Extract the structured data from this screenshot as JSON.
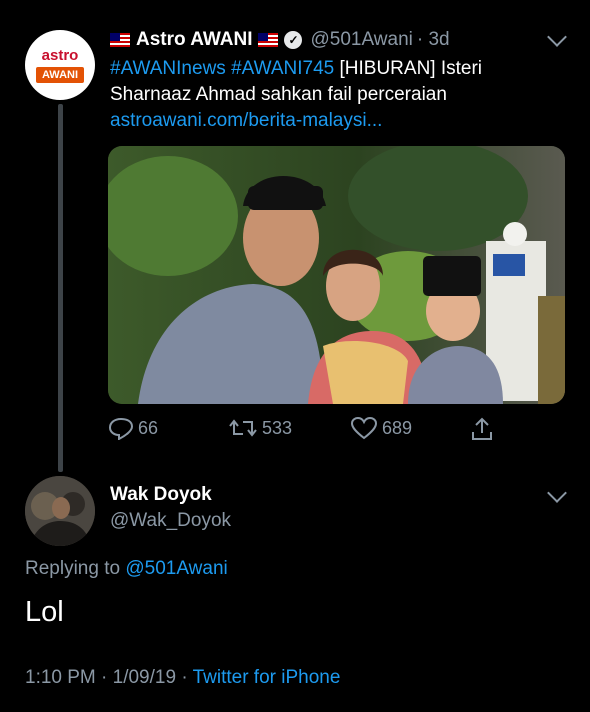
{
  "original_tweet": {
    "avatar_logo": {
      "top": "astro",
      "bottom": "AWANI"
    },
    "display_name": "Astro AWANI",
    "handle": "@501Awani",
    "age": "· 3d",
    "hashtag_1": "#AWANInews",
    "hashtag_2": "#AWANI745",
    "text": " [HIBURAN] Isteri Sharnaaz Ahmad sahkan fail perceraian",
    "link": "astroawani.com/berita-malaysi...",
    "stats": {
      "replies": "66",
      "retweets": "533",
      "likes": "689"
    }
  },
  "reply_tweet": {
    "display_name": "Wak Doyok",
    "handle": "@Wak_Doyok",
    "replying_prefix": "Replying to ",
    "replying_to": "@501Awani",
    "text": "Lol",
    "time": "1:10 PM · 1/09/19 · ",
    "source": "Twitter for iPhone"
  },
  "icons": [
    "flag-icon",
    "verified-icon",
    "chevron-down-icon",
    "reply-icon",
    "retweet-icon",
    "like-icon",
    "share-icon"
  ],
  "colors": {
    "background": "#000000",
    "link": "#1d9bf0",
    "secondary_text": "#8b98a5",
    "primary_text": "#ffffff"
  }
}
